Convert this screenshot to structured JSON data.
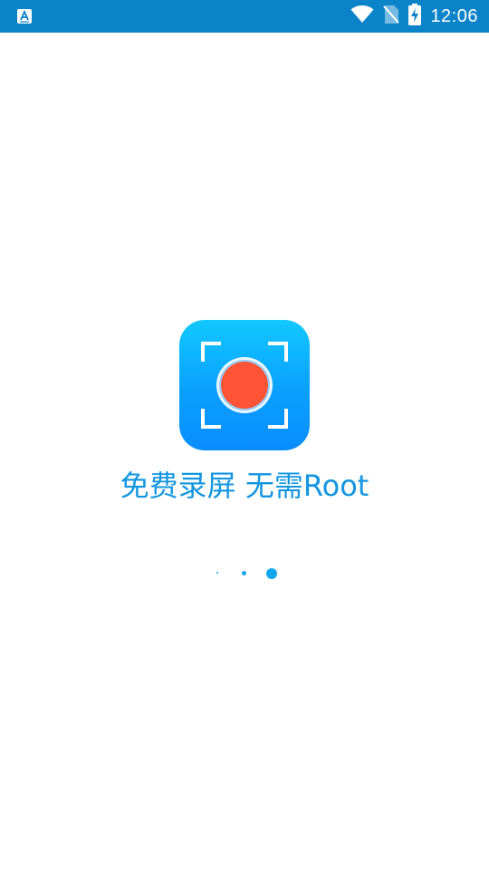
{
  "status_bar": {
    "time": "12:06",
    "background": "#0a83c9",
    "left_icon": "accessibility-a-icon",
    "right_icons": [
      "wifi-icon",
      "no-sim-icon",
      "battery-charging-icon"
    ]
  },
  "splash": {
    "app_icon": "screen-record-icon",
    "tagline": "免费录屏 无需Root",
    "tagline_color": "#1296e0",
    "icon_gradient": [
      "#12c8ff",
      "#0a8dff"
    ],
    "record_color": "#ff5435"
  },
  "pager": {
    "page_count": 3,
    "active_index": 2,
    "dot_color": "#12a6f0"
  }
}
